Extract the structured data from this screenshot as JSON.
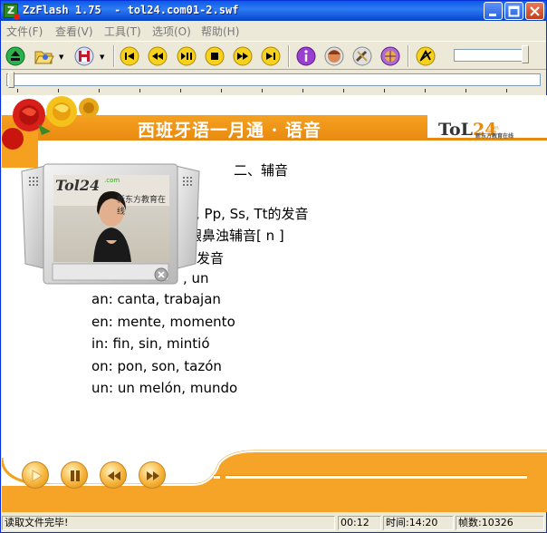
{
  "window": {
    "title": "ZzFlash 1.75  - tol24.com01-2.swf",
    "app_icon_letter": "Z"
  },
  "menu": [
    "文件(F)",
    "查看(V)",
    "工具(T)",
    "选项(O)",
    "帮助(H)"
  ],
  "toolbar": {
    "buttons": [
      "eject-icon",
      "open-folder-icon",
      "save-disk-icon",
      "skip-back-icon",
      "rewind-icon",
      "play-pause-icon",
      "stop-icon",
      "fast-forward-icon",
      "skip-forward-icon",
      "info-icon",
      "face-icon",
      "tools-icon",
      "globe-icon",
      "no-loop-icon"
    ]
  },
  "slide": {
    "banner_title": "西班牙语一月通 · 语音",
    "logo_tol": "ToL",
    "logo_num": "24",
    "logo_com": ".com",
    "logo_sub": "新东方教育在线",
    "heading": "二、辅音",
    "lines": [
      ", Pp, Ss, Tt的发音",
      "龈鼻浊辅音[ n ]",
      "的发音",
      ", un",
      "an: canta, trabajan",
      "en: mente, momento",
      "in: fin, sin, mintió",
      "on: pon, son, tazón",
      "un: un melón, mundo"
    ],
    "video_logo": "Tol24",
    "video_logo_com": ".com",
    "video_sub": "新东方教育在线"
  },
  "player": {
    "progress": 0.02
  },
  "status": {
    "message": "读取文件完毕!",
    "elapsed": "00:12",
    "time": "时间:14:20",
    "frames": "帧数:10326"
  },
  "colors": {
    "titlebar": "#0a5ae8",
    "banner": "#f39a1c",
    "accent": "#e88a10"
  }
}
